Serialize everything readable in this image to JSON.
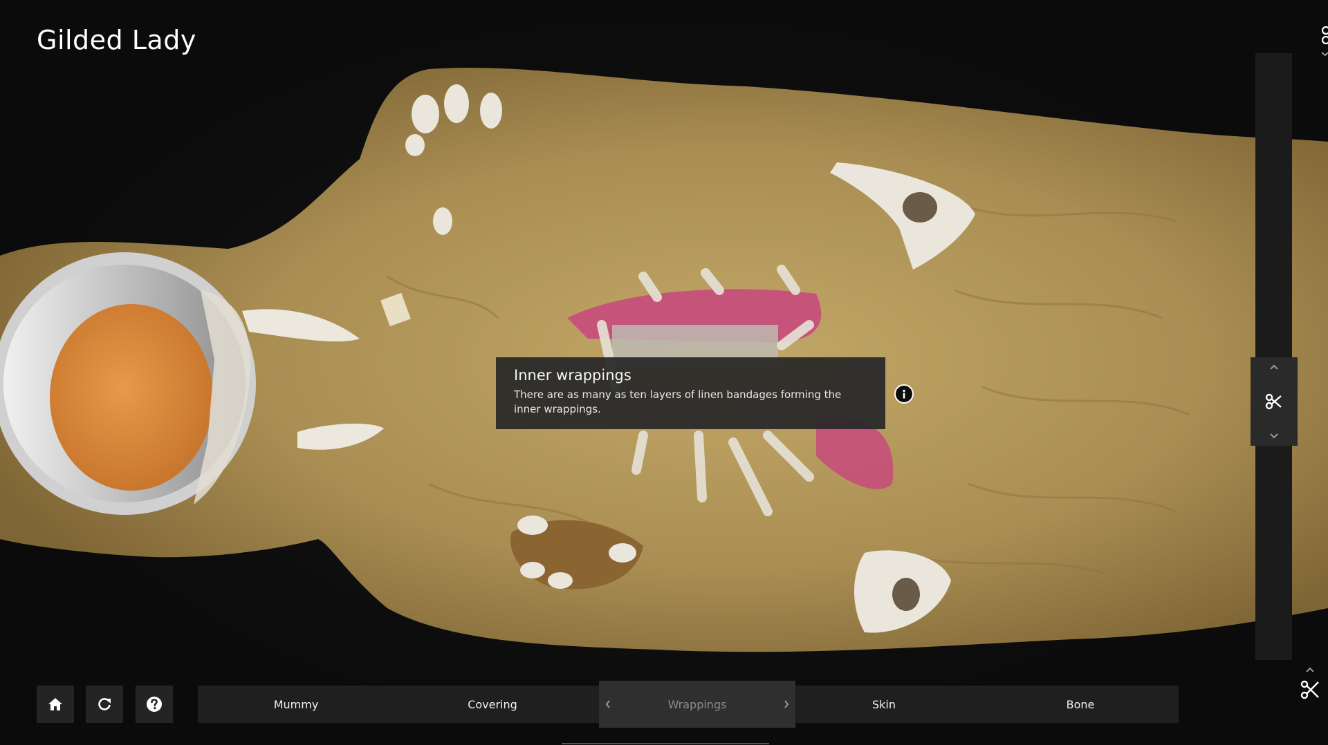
{
  "app": {
    "title": "Gilded Lady"
  },
  "tooltip": {
    "title": "Inner wrappings",
    "body": "There are as many as ten layers of linen bandages forming the inner wrappings."
  },
  "toolbar": {
    "icons": [
      "home-icon",
      "refresh-icon",
      "help-icon"
    ]
  },
  "layers": {
    "tabs": [
      "Mummy",
      "Covering",
      "Wrappings",
      "Skin",
      "Bone"
    ],
    "active_index": 2
  },
  "colors": {
    "linen": "#b39a5c",
    "skull_fill": "#d98a3b",
    "tissue_pink": "#c8457e",
    "bone": "#e6e2d8",
    "panel": "#242424"
  }
}
